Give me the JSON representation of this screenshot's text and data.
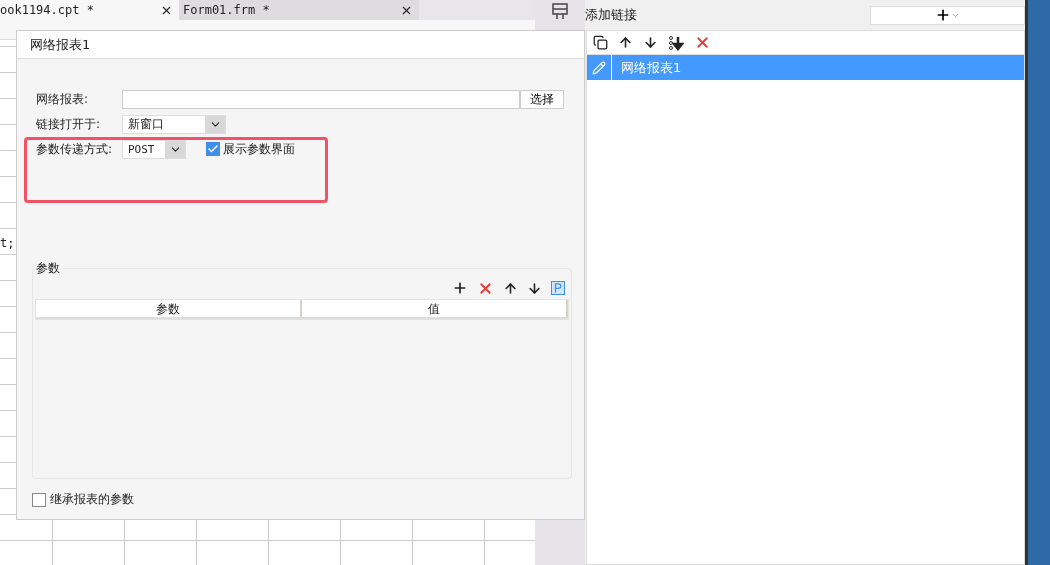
{
  "editor_tabs": [
    {
      "label": "ook1194.cpt *",
      "selected": true
    },
    {
      "label": "Form01.frm *",
      "selected": false
    }
  ],
  "editor_fragment": "t;",
  "dialog": {
    "title": "网络报表1",
    "report": {
      "label": "网络报表:",
      "button": "选择"
    },
    "open_in": {
      "label": "链接打开于:",
      "value": "新窗口"
    },
    "method": {
      "label": "参数传递方式:",
      "value": "POST"
    },
    "show_params": {
      "label": "展示参数界面",
      "checked": true
    },
    "params": {
      "title": "参数",
      "columns": [
        "参数",
        "值"
      ]
    },
    "inherit": {
      "label": "继承报表的参数",
      "checked": false
    }
  },
  "links_panel": {
    "title": "添加链接",
    "links": [
      {
        "label": "网络报表1",
        "selected": true
      }
    ]
  }
}
